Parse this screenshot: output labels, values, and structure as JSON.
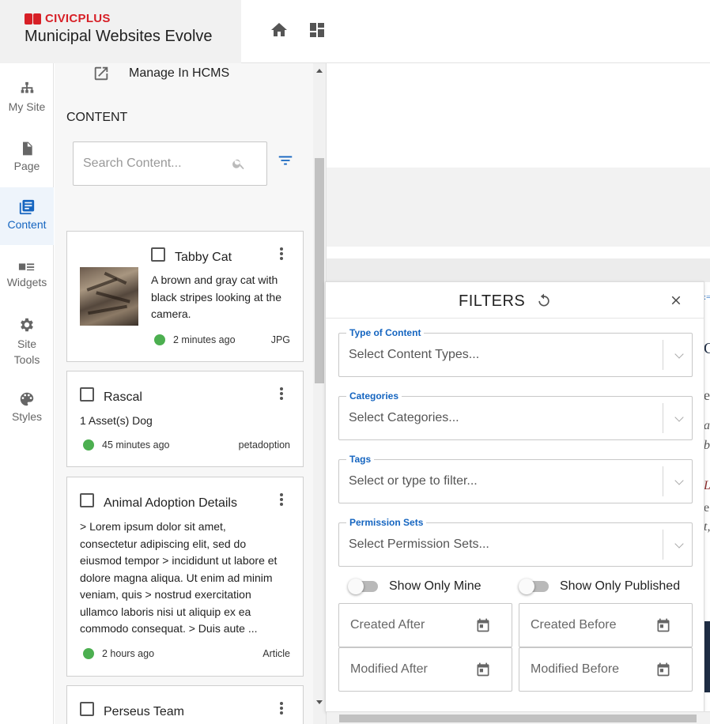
{
  "header": {
    "brand_prefix": "CIVIC",
    "brand_suffix": "PLUS",
    "app_title": "Municipal Websites Evolve"
  },
  "nav": {
    "items": [
      {
        "label": "My Site",
        "icon": "sitemap-icon"
      },
      {
        "label": "Page",
        "icon": "page-icon"
      },
      {
        "label": "Content",
        "icon": "content-icon"
      },
      {
        "label": "Widgets",
        "icon": "widgets-icon"
      },
      {
        "label_line1": "Site",
        "label_line2": "Tools",
        "icon": "gear-icon"
      },
      {
        "label": "Styles",
        "icon": "palette-icon"
      }
    ]
  },
  "panel": {
    "manage_label": "Manage In HCMS",
    "section_title": "CONTENT",
    "search_placeholder": "Search Content...",
    "cards": [
      {
        "title": "Tabby Cat",
        "desc_lines": [
          "A brown and gray cat with",
          "black stripes looking at the",
          "camera."
        ],
        "time": "2 minutes ago",
        "kind": "JPG"
      },
      {
        "title": "Rascal",
        "desc_lines": [
          "1 Asset(s) Dog"
        ],
        "time": "45 minutes ago",
        "kind": "petadoption"
      },
      {
        "title": "Animal Adoption Details",
        "desc_lines": [
          "> Lorem ipsum dolor sit amet,",
          "consectetur adipiscing elit, sed do",
          "eiusmod tempor > incididunt ut labore et",
          "dolore magna aliqua. Ut enim ad minim",
          "veniam, quis > nostrud exercitation",
          "ullamco laboris nisi ut aliquip ex ea",
          "commodo consequat. > Duis aute ..."
        ],
        "time": "2 hours ago",
        "kind": "Article"
      },
      {
        "title": "Perseus Team"
      }
    ]
  },
  "filters": {
    "title": "FILTERS",
    "fields": [
      {
        "label": "Type of Content",
        "placeholder": "Select Content Types..."
      },
      {
        "label": "Categories",
        "placeholder": "Select Categories..."
      },
      {
        "label": "Tags",
        "placeholder": "Select or type to filter..."
      },
      {
        "label": "Permission Sets",
        "placeholder": "Select Permission Sets..."
      }
    ],
    "toggle_mine": "Show Only Mine",
    "toggle_published": "Show Only Published",
    "created_after": "Created After",
    "created_before": "Created Before",
    "modified_after": "Modified After",
    "modified_before": "Modified Before"
  },
  "preview": {
    "edge_fragments": [
      ":=",
      "C",
      "e",
      "a",
      "b",
      "L",
      "e",
      "t,"
    ]
  },
  "colors": {
    "accent": "#1565c0",
    "brand_red": "#d71f26",
    "status_green": "#4caf50"
  }
}
